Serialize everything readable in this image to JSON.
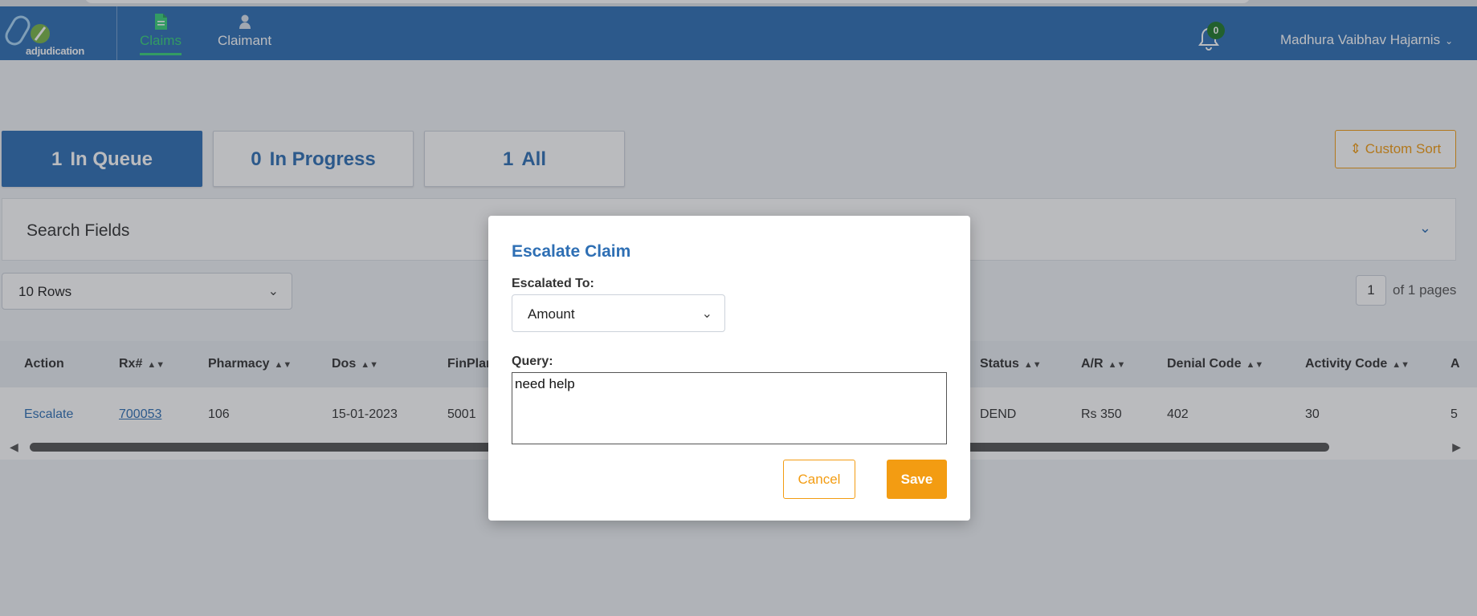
{
  "app": {
    "logo_text": "adjudication",
    "nav": [
      {
        "label": "Claims",
        "icon": "document-icon",
        "active": true
      },
      {
        "label": "Claimant",
        "icon": "person-icon",
        "active": false
      }
    ],
    "notifications_count": "0",
    "user_name": "Madhura Vaibhav Hajarnis",
    "colors": {
      "primary": "#2e6fb4",
      "accent": "#f39c12",
      "active_nav": "#38d07a"
    }
  },
  "queue_tabs": [
    {
      "count": "1",
      "label": "In Queue",
      "active": true
    },
    {
      "count": "0",
      "label": "In Progress",
      "active": false
    },
    {
      "count": "1",
      "label": "All",
      "active": false
    }
  ],
  "custom_sort_label": "Custom Sort",
  "search_fields_label": "Search Fields",
  "rows_select_value": "10 Rows",
  "pager": {
    "current": "1",
    "of_text": "of 1 pages"
  },
  "table": {
    "columns": [
      "Action",
      "Rx#",
      "Pharmacy",
      "Dos",
      "FinPlan",
      "Status",
      "A/R",
      "Denial Code",
      "Activity Code",
      "A"
    ],
    "row": {
      "action": "Escalate",
      "rx": "700053",
      "pharmacy": "106",
      "dos": "15-01-2023",
      "finplan": "5001",
      "status": "DEND",
      "ar": "Rs 350",
      "denial_code": "402",
      "activity_code": "30",
      "last": "5"
    }
  },
  "modal": {
    "title": "Escalate Claim",
    "escalated_to_label": "Escalated To:",
    "escalated_to_value": "Amount",
    "query_label": "Query:",
    "query_value": "need help",
    "cancel_label": "Cancel",
    "save_label": "Save"
  }
}
